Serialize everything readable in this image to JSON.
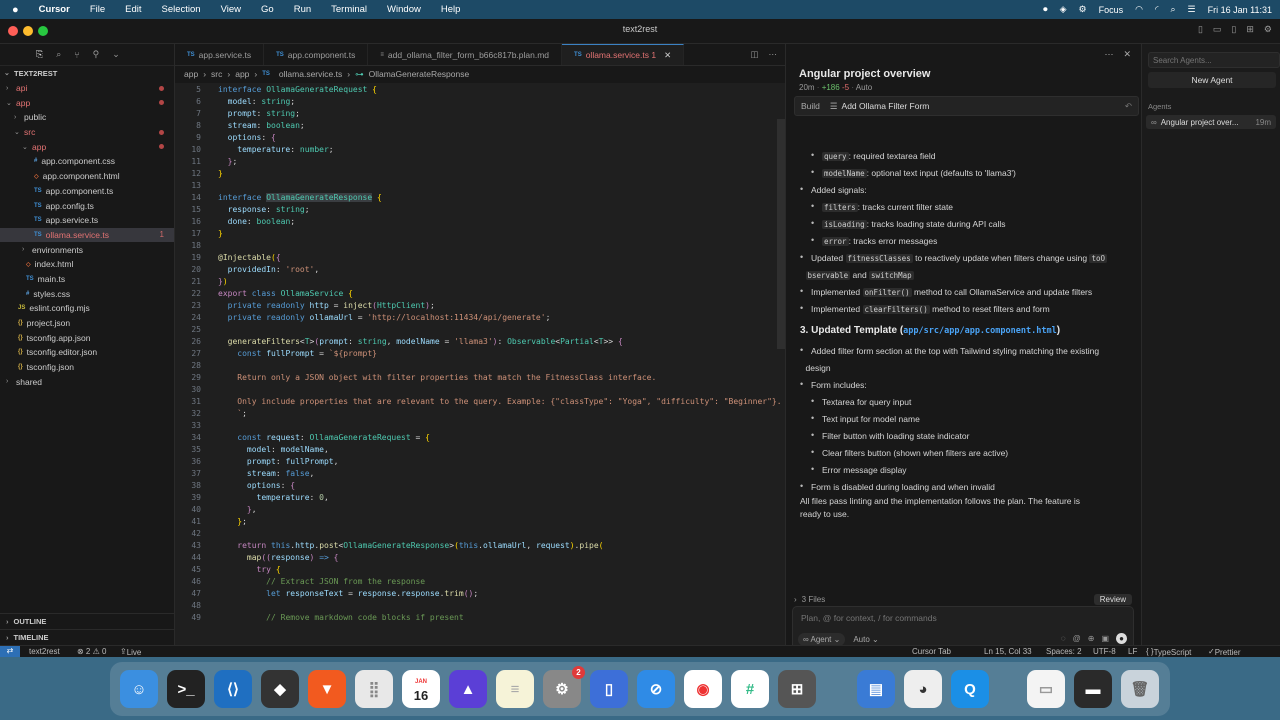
{
  "menubar": {
    "apple": "",
    "items": [
      "Cursor",
      "File",
      "Edit",
      "Selection",
      "View",
      "Go",
      "Run",
      "Terminal",
      "Window",
      "Help"
    ],
    "focus": "Focus",
    "datetime": "Fri 16 Jan  11:31"
  },
  "window": {
    "title": "text2rest"
  },
  "explorer": {
    "root": "TEXT2REST",
    "rows": [
      {
        "label": "api",
        "kind": "folder",
        "state": "closed",
        "depth": 0,
        "color": "red",
        "dot": true
      },
      {
        "label": "app",
        "kind": "folder",
        "state": "open",
        "depth": 0,
        "color": "red",
        "dot": true
      },
      {
        "label": "public",
        "kind": "folder",
        "state": "closed",
        "depth": 1,
        "color": "normal"
      },
      {
        "label": "src",
        "kind": "folder",
        "state": "open",
        "depth": 1,
        "color": "red",
        "dot": true
      },
      {
        "label": "app",
        "kind": "folder",
        "state": "open",
        "depth": 2,
        "color": "red",
        "dot": true
      },
      {
        "label": "app.component.css",
        "kind": "css",
        "depth": 3
      },
      {
        "label": "app.component.html",
        "kind": "html",
        "depth": 3
      },
      {
        "label": "app.component.ts",
        "kind": "ts",
        "depth": 3
      },
      {
        "label": "app.config.ts",
        "kind": "ts",
        "depth": 3
      },
      {
        "label": "app.service.ts",
        "kind": "ts",
        "depth": 3
      },
      {
        "label": "ollama.service.ts",
        "kind": "ts",
        "depth": 3,
        "color": "red",
        "count": "1",
        "selected": true
      },
      {
        "label": "environments",
        "kind": "folder",
        "state": "closed",
        "depth": 2
      },
      {
        "label": "index.html",
        "kind": "html",
        "depth": 2
      },
      {
        "label": "main.ts",
        "kind": "ts",
        "depth": 2
      },
      {
        "label": "styles.css",
        "kind": "css",
        "depth": 2
      },
      {
        "label": "eslint.config.mjs",
        "kind": "js",
        "depth": 1
      },
      {
        "label": "project.json",
        "kind": "json",
        "depth": 1
      },
      {
        "label": "tsconfig.app.json",
        "kind": "json",
        "depth": 1
      },
      {
        "label": "tsconfig.editor.json",
        "kind": "json",
        "depth": 1
      },
      {
        "label": "tsconfig.json",
        "kind": "json",
        "depth": 1
      },
      {
        "label": "shared",
        "kind": "folder",
        "state": "closed",
        "depth": 0
      }
    ],
    "outline": "OUTLINE",
    "timeline": "TIMELINE"
  },
  "tabs": [
    {
      "label": "app.service.ts",
      "active": false
    },
    {
      "label": "app.component.ts",
      "active": false
    },
    {
      "label": "add_ollama_filter_form_b66c817b.plan.md",
      "active": false
    },
    {
      "label": "ollama.service.ts 1",
      "active": true
    }
  ],
  "breadcrumb": [
    "app",
    "src",
    "app",
    "ollama.service.ts",
    "OllamaGenerateResponse"
  ],
  "code": [
    {
      "n": "5",
      "h": "<span class='k'>interface</span> <span class='t'>OllamaGenerateRequest</span> <span class='y'>{</span>"
    },
    {
      "n": "6",
      "h": "  <span class='p'>model</span>: <span class='t'>string</span>;"
    },
    {
      "n": "7",
      "h": "  <span class='p'>prompt</span>: <span class='t'>string</span>;"
    },
    {
      "n": "8",
      "h": "  <span class='p'>stream</span>: <span class='t'>boolean</span>;"
    },
    {
      "n": "9",
      "h": "  <span class='p'>options</span>: <span class='ky'>{</span>"
    },
    {
      "n": "10",
      "h": "    <span class='p'>temperature</span>: <span class='t'>number</span>;"
    },
    {
      "n": "11",
      "h": "  <span class='ky'>}</span>;"
    },
    {
      "n": "12",
      "h": "<span class='y'>}</span>"
    },
    {
      "n": "13",
      "h": ""
    },
    {
      "n": "14",
      "h": "<span class='k'>interface</span> <span class='t hl'>OllamaGenerateResponse</span> <span class='y'>{</span>"
    },
    {
      "n": "15",
      "h": "  <span class='p'>response</span>: <span class='t'>string</span>;"
    },
    {
      "n": "16",
      "h": "  <span class='p'>done</span>: <span class='t'>boolean</span>;"
    },
    {
      "n": "17",
      "h": "<span class='y'>}</span>"
    },
    {
      "n": "18",
      "h": ""
    },
    {
      "n": "19",
      "h": "<span class='f'>@Injectable</span><span class='y'>(</span><span class='ky'>{</span>"
    },
    {
      "n": "20",
      "h": "  <span class='p'>providedIn</span>: <span class='s'>'root'</span>,"
    },
    {
      "n": "21",
      "h": "<span class='ky'>}</span><span class='y'>)</span>"
    },
    {
      "n": "22",
      "h": "<span class='ky'>export</span> <span class='k'>class</span> <span class='t'>OllamaService</span> <span class='y'>{</span>"
    },
    {
      "n": "23",
      "h": "  <span class='k'>private readonly</span> <span class='p'>http</span> = <span class='f'>inject</span><span class='ky'>(</span><span class='t'>HttpClient</span><span class='ky'>)</span>;"
    },
    {
      "n": "24",
      "h": "  <span class='k'>private readonly</span> <span class='p'>ollamaUrl</span> = <span class='s'>'http://localhost:11434/api/generate'</span>;"
    },
    {
      "n": "25",
      "h": ""
    },
    {
      "n": "26",
      "h": "  <span class='f'>generateFilters</span>&lt;<span class='t'>T</span>&gt;<span class='ky'>(</span><span class='p'>prompt</span>: <span class='t'>string</span>, <span class='p'>modelName</span> = <span class='s'>'llama3'</span><span class='ky'>)</span>: <span class='t'>Observable</span>&lt;<span class='t'>Partial</span>&lt;<span class='t'>T</span>&gt;&gt; <span class='ky'>{</span>"
    },
    {
      "n": "27",
      "h": "    <span class='k'>const</span> <span class='p'>fullPrompt</span> = <span class='s'>`${prompt}</span>"
    },
    {
      "n": "28",
      "h": ""
    },
    {
      "n": "29",
      "h": "<span class='s'>    Return only a JSON object with filter properties that match the FitnessClass interface.</span>"
    },
    {
      "n": "30",
      "h": ""
    },
    {
      "n": "31",
      "h": "<span class='s'>    Only include properties that are relevant to the query. Example: {\"classType\": \"Yoga\", \"difficulty\": \"Beginner\"}.</span>"
    },
    {
      "n": "32",
      "h": "<span class='s'>    `</span>;"
    },
    {
      "n": "33",
      "h": ""
    },
    {
      "n": "34",
      "h": "    <span class='k'>const</span> <span class='p'>request</span>: <span class='t'>OllamaGenerateRequest</span> = <span class='y'>{</span>"
    },
    {
      "n": "35",
      "h": "      <span class='p'>model</span>: <span class='p'>modelName</span>,"
    },
    {
      "n": "36",
      "h": "      <span class='p'>prompt</span>: <span class='p'>fullPrompt</span>,"
    },
    {
      "n": "37",
      "h": "      <span class='p'>stream</span>: <span class='k'>false</span>,"
    },
    {
      "n": "38",
      "h": "      <span class='p'>options</span>: <span class='ky'>{</span>"
    },
    {
      "n": "39",
      "h": "        <span class='p'>temperature</span>: <span class='n'>0</span>,"
    },
    {
      "n": "40",
      "h": "      <span class='ky'>}</span>,"
    },
    {
      "n": "41",
      "h": "    <span class='y'>}</span>;"
    },
    {
      "n": "42",
      "h": ""
    },
    {
      "n": "43",
      "h": "    <span class='ky'>return</span> <span class='k'>this</span>.<span class='p'>http</span>.<span class='f'>post</span>&lt;<span class='t'>OllamaGenerateResponse</span>&gt;<span class='y'>(</span><span class='k'>this</span>.<span class='p'>ollamaUrl</span>, <span class='p'>request</span><span class='y'>)</span>.<span class='f'>pipe</span><span class='y'>(</span>"
    },
    {
      "n": "44",
      "h": "      <span class='f'>map</span><span class='ky'>((</span><span class='p'>response</span><span class='ky'>)</span> <span class='k'>=&gt;</span> <span class='ky'>{</span>"
    },
    {
      "n": "45",
      "h": "        <span class='ky'>try</span> <span class='y'>{</span>"
    },
    {
      "n": "46",
      "h": "          <span class='c'>// Extract JSON from the response</span>"
    },
    {
      "n": "47",
      "h": "          <span class='k'>let</span> <span class='p'>responseText</span> = <span class='p'>response</span>.<span class='p'>response</span>.<span class='f'>trim</span><span class='ky'>()</span>;"
    },
    {
      "n": "48",
      "h": ""
    },
    {
      "n": "49",
      "h": "          <span class='c'>// Remove markdown code blocks if present</span>"
    }
  ],
  "chat": {
    "title": "Angular project overview",
    "meta_time": "20m",
    "meta_plus": "+186",
    "meta_minus": "-5",
    "meta_auto": "Auto",
    "build_label": "Build",
    "build_task": "Add Ollama Filter Form",
    "lines": [
      {
        "indent": 2,
        "code": "query",
        "text": ": required textarea field"
      },
      {
        "indent": 2,
        "code": "modelName",
        "text": ": optional text input (defaults to 'llama3')"
      },
      {
        "indent": 1,
        "text": "Added signals:"
      },
      {
        "indent": 2,
        "code": "filters",
        "text": ": tracks current filter state"
      },
      {
        "indent": 2,
        "code": "isLoading",
        "text": ": tracks loading state during API calls"
      },
      {
        "indent": 2,
        "code": "error",
        "text": ": tracks error messages"
      },
      {
        "indent": 1,
        "pre": "Updated ",
        "code": "fitnessClasses",
        "text": " to reactively update when filters change using ",
        "code2": "toO"
      },
      {
        "indent": 1.5,
        "code": "bservable",
        "text": " and ",
        "code2": "switchMap"
      },
      {
        "indent": 1,
        "pre": "Implemented ",
        "code": "onFilter()",
        "text": " method to call OllamaService and update filters"
      },
      {
        "indent": 1,
        "pre": "Implemented ",
        "code": "clearFilters()",
        "text": " method to reset filters and form"
      }
    ],
    "section3_title": "3. Updated Template (",
    "section3_link": "app/src/app/app.component.html",
    "section3_end": ")",
    "lines2": [
      {
        "indent": 1,
        "text": "Added filter form section at the top with Tailwind styling matching the existing"
      },
      {
        "indent": 1.5,
        "text": "design"
      },
      {
        "indent": 1,
        "text": "Form includes:"
      },
      {
        "indent": 2,
        "text": "Textarea for query input"
      },
      {
        "indent": 2,
        "text": "Text input for model name"
      },
      {
        "indent": 2,
        "text": "Filter button with loading state indicator"
      },
      {
        "indent": 2,
        "text": "Clear filters button (shown when filters are active)"
      },
      {
        "indent": 2,
        "text": "Error message display"
      },
      {
        "indent": 1,
        "text": "Form is disabled during loading and when invalid"
      }
    ],
    "summary1": "All files pass linting and the implementation follows the plan. The feature is",
    "summary2": "ready to use.",
    "files_label": "3 Files",
    "review": "Review",
    "input_placeholder": "Plan, @ for context, / for commands",
    "agent_mode": "Agent",
    "model": "Auto"
  },
  "agents": {
    "search_placeholder": "Search Agents...",
    "new_agent": "New Agent",
    "section": "Agents",
    "item_label": "Angular project over...",
    "item_time": "19m"
  },
  "status": {
    "branch": "text2rest",
    "problems": "⊗ 2 ⚠ 0",
    "live_share": "Live Share",
    "cursor_tab": "Cursor Tab",
    "position": "Ln 15, Col 33",
    "spaces": "Spaces: 2",
    "encoding": "UTF-8",
    "eol": "LF",
    "language": "TypeScript",
    "prettier": "Prettier"
  },
  "dock": {
    "calendar_month": "JAN",
    "calendar_day": "16",
    "settings_badge": "2"
  },
  "colors": {
    "accent": "#3b82c4",
    "error": "#e37373",
    "link": "#4aa3f5"
  }
}
